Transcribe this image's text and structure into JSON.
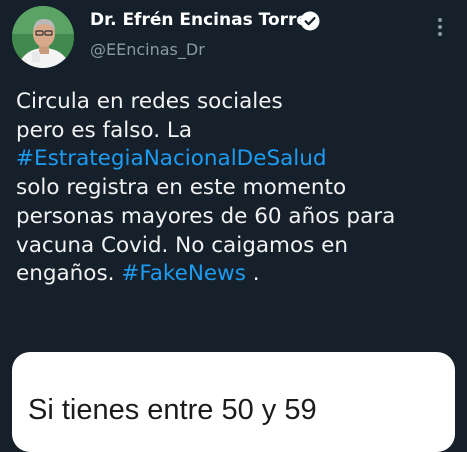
{
  "author": {
    "name": "Dr. Efrén Encinas Torres",
    "handle": "@EEncinas_Dr",
    "verified_icon": "verified-badge-icon",
    "menu_icon": "more-vertical-icon"
  },
  "tweet": {
    "lines": [
      "Circula en redes sociales",
      "pero es falso. La",
      "#EstrategiaNacionalDeSalud",
      "solo registra en este momento",
      "personas mayores de 60 años para",
      "vacuna Covid. No caigamos en",
      "engaños.",
      "#FakeNews",
      " ."
    ]
  },
  "media": {
    "text": "Si tienes entre 50 y 59"
  },
  "colors": {
    "background": "#15202b",
    "hashtag": "#1d9bf0",
    "handle": "#8b98a5"
  }
}
